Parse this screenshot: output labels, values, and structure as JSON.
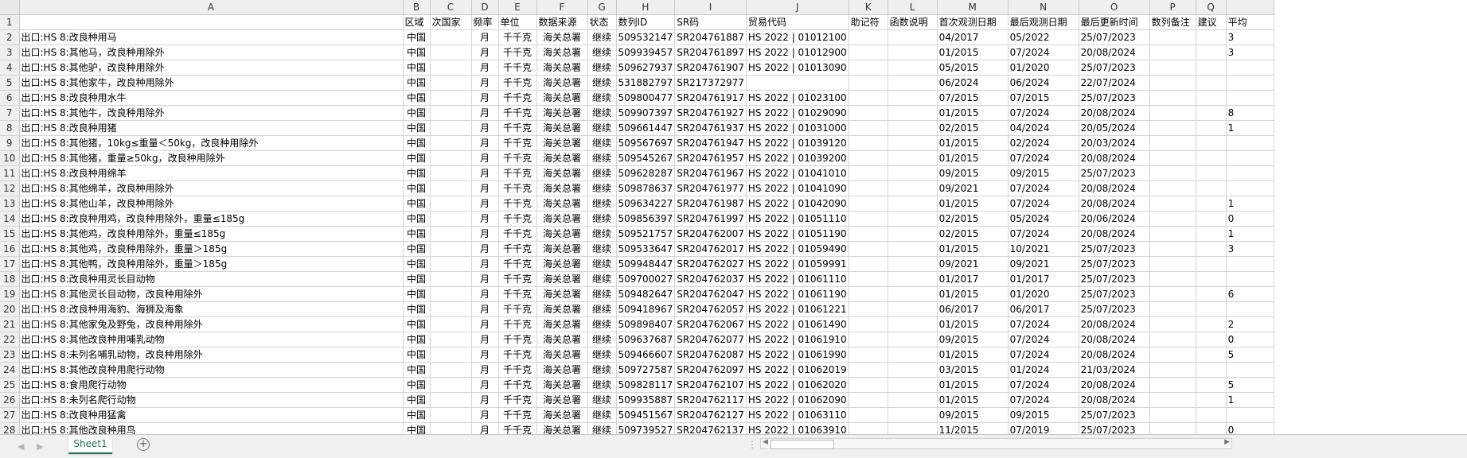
{
  "columns": [
    {
      "letter": "A",
      "header": "",
      "align": "left"
    },
    {
      "letter": "B",
      "header": "区域",
      "align": "center"
    },
    {
      "letter": "C",
      "header": "次国家",
      "align": "center"
    },
    {
      "letter": "D",
      "header": "频率",
      "align": "center"
    },
    {
      "letter": "E",
      "header": "单位",
      "align": "center"
    },
    {
      "letter": "F",
      "header": "数据来源",
      "align": "center"
    },
    {
      "letter": "G",
      "header": "状态",
      "align": "center"
    },
    {
      "letter": "H",
      "header": "数列ID",
      "align": "center"
    },
    {
      "letter": "I",
      "header": "SR码",
      "align": "left"
    },
    {
      "letter": "J",
      "header": "贸易代码",
      "align": "left"
    },
    {
      "letter": "K",
      "header": "助记符",
      "align": "left"
    },
    {
      "letter": "L",
      "header": "函数说明",
      "align": "left"
    },
    {
      "letter": "M",
      "header": "首次观测日期",
      "align": "left"
    },
    {
      "letter": "N",
      "header": "最后观测日期",
      "align": "left"
    },
    {
      "letter": "O",
      "header": "最后更新时间",
      "align": "left"
    },
    {
      "letter": "P",
      "header": "数列备注",
      "align": "left"
    },
    {
      "letter": "Q",
      "header": "建议",
      "align": "left"
    },
    {
      "letter": "",
      "header": "平均",
      "align": "left"
    }
  ],
  "rows": [
    {
      "num": "2",
      "cells": [
        "出口:HS 8:改良种用马",
        "中国",
        "",
        "月",
        "千千克",
        "海关总署",
        "继续",
        "509532147",
        "SR204761887",
        "HS 2022 | 01012100",
        "",
        "",
        "04/2017",
        "05/2022",
        "25/07/2023",
        "",
        "",
        "3"
      ]
    },
    {
      "num": "3",
      "cells": [
        "出口:HS 8:其他马，改良种用除外",
        "中国",
        "",
        "月",
        "千千克",
        "海关总署",
        "继续",
        "509939457",
        "SR204761897",
        "HS 2022 | 01012900",
        "",
        "",
        "01/2015",
        "07/2024",
        "20/08/2024",
        "",
        "",
        "3"
      ]
    },
    {
      "num": "4",
      "cells": [
        "出口:HS 8:其他驴，改良种用除外",
        "中国",
        "",
        "月",
        "千千克",
        "海关总署",
        "继续",
        "509627937",
        "SR204761907",
        "HS 2022 | 01013090",
        "",
        "",
        "05/2015",
        "01/2020",
        "25/07/2023",
        "",
        "",
        ""
      ]
    },
    {
      "num": "5",
      "cells": [
        "出口:HS 8:其他家牛，改良种用除外",
        "中国",
        "",
        "月",
        "千千克",
        "海关总署",
        "继续",
        "531882797",
        "SR217372977",
        "",
        "",
        "",
        "06/2024",
        "06/2024",
        "22/07/2024",
        "",
        "",
        ""
      ]
    },
    {
      "num": "6",
      "cells": [
        "出口:HS 8:改良种用水牛",
        "中国",
        "",
        "月",
        "千千克",
        "海关总署",
        "继续",
        "509800477",
        "SR204761917",
        "HS 2022 | 01023100",
        "",
        "",
        "07/2015",
        "07/2015",
        "25/07/2023",
        "",
        "",
        ""
      ]
    },
    {
      "num": "7",
      "cells": [
        "出口:HS 8:其他牛，改良种用除外",
        "中国",
        "",
        "月",
        "千千克",
        "海关总署",
        "继续",
        "509907397",
        "SR204761927",
        "HS 2022 | 01029090",
        "",
        "",
        "01/2015",
        "07/2024",
        "20/08/2024",
        "",
        "",
        "8"
      ]
    },
    {
      "num": "8",
      "cells": [
        "出口:HS 8:改良种用猪",
        "中国",
        "",
        "月",
        "千千克",
        "海关总署",
        "继续",
        "509661447",
        "SR204761937",
        "HS 2022 | 01031000",
        "",
        "",
        "02/2015",
        "04/2024",
        "20/05/2024",
        "",
        "",
        "1"
      ]
    },
    {
      "num": "9",
      "cells": [
        "出口:HS 8:其他猪，10kg≤重量＜50kg，改良种用除外",
        "中国",
        "",
        "月",
        "千千克",
        "海关总署",
        "继续",
        "509567697",
        "SR204761947",
        "HS 2022 | 01039120",
        "",
        "",
        "01/2015",
        "02/2024",
        "20/03/2024",
        "",
        "",
        ""
      ]
    },
    {
      "num": "10",
      "cells": [
        "出口:HS 8:其他猪，重量≥50kg，改良种用除外",
        "中国",
        "",
        "月",
        "千千克",
        "海关总署",
        "继续",
        "509545267",
        "SR204761957",
        "HS 2022 | 01039200",
        "",
        "",
        "01/2015",
        "07/2024",
        "20/08/2024",
        "",
        "",
        ""
      ]
    },
    {
      "num": "11",
      "cells": [
        "出口:HS 8:改良种用绵羊",
        "中国",
        "",
        "月",
        "千千克",
        "海关总署",
        "继续",
        "509628287",
        "SR204761967",
        "HS 2022 | 01041010",
        "",
        "",
        "09/2015",
        "09/2015",
        "25/07/2023",
        "",
        "",
        ""
      ]
    },
    {
      "num": "12",
      "cells": [
        "出口:HS 8:其他绵羊，改良种用除外",
        "中国",
        "",
        "月",
        "千千克",
        "海关总署",
        "继续",
        "509878637",
        "SR204761977",
        "HS 2022 | 01041090",
        "",
        "",
        "09/2021",
        "07/2024",
        "20/08/2024",
        "",
        "",
        ""
      ]
    },
    {
      "num": "13",
      "cells": [
        "出口:HS 8:其他山羊，改良种用除外",
        "中国",
        "",
        "月",
        "千千克",
        "海关总署",
        "继续",
        "509634227",
        "SR204761987",
        "HS 2022 | 01042090",
        "",
        "",
        "01/2015",
        "07/2024",
        "20/08/2024",
        "",
        "",
        "1"
      ]
    },
    {
      "num": "14",
      "cells": [
        "出口:HS 8:改良种用鸡，改良种用除外，重量≤185g",
        "中国",
        "",
        "月",
        "千千克",
        "海关总署",
        "继续",
        "509856397",
        "SR204761997",
        "HS 2022 | 01051110",
        "",
        "",
        "02/2015",
        "05/2024",
        "20/06/2024",
        "",
        "",
        "0"
      ]
    },
    {
      "num": "15",
      "cells": [
        "出口:HS 8:其他鸡，改良种用除外，重量≤185g",
        "中国",
        "",
        "月",
        "千千克",
        "海关总署",
        "继续",
        "509521757",
        "SR204762007",
        "HS 2022 | 01051190",
        "",
        "",
        "02/2015",
        "07/2024",
        "20/08/2024",
        "",
        "",
        "1"
      ]
    },
    {
      "num": "16",
      "cells": [
        "出口:HS 8:其他鸡，改良种用除外，重量＞185g",
        "中国",
        "",
        "月",
        "千千克",
        "海关总署",
        "继续",
        "509533647",
        "SR204762017",
        "HS 2022 | 01059490",
        "",
        "",
        "01/2015",
        "10/2021",
        "25/07/2023",
        "",
        "",
        "3"
      ]
    },
    {
      "num": "17",
      "cells": [
        "出口:HS 8:其他鸭，改良种用除外，重量＞185g",
        "中国",
        "",
        "月",
        "千千克",
        "海关总署",
        "继续",
        "509948447",
        "SR204762027",
        "HS 2022 | 01059991",
        "",
        "",
        "09/2021",
        "09/2021",
        "25/07/2023",
        "",
        "",
        ""
      ]
    },
    {
      "num": "18",
      "cells": [
        "出口:HS 8:改良种用灵长目动物",
        "中国",
        "",
        "月",
        "千千克",
        "海关总署",
        "继续",
        "509700027",
        "SR204762037",
        "HS 2022 | 01061110",
        "",
        "",
        "01/2017",
        "01/2017",
        "25/07/2023",
        "",
        "",
        ""
      ]
    },
    {
      "num": "19",
      "cells": [
        "出口:HS 8:其他灵长目动物，改良种用除外",
        "中国",
        "",
        "月",
        "千千克",
        "海关总署",
        "继续",
        "509482647",
        "SR204762047",
        "HS 2022 | 01061190",
        "",
        "",
        "01/2015",
        "01/2020",
        "25/07/2023",
        "",
        "",
        "6"
      ]
    },
    {
      "num": "20",
      "cells": [
        "出口:HS 8:改良种用海豹、海狮及海象",
        "中国",
        "",
        "月",
        "千千克",
        "海关总署",
        "继续",
        "509418967",
        "SR204762057",
        "HS 2022 | 01061221",
        "",
        "",
        "06/2017",
        "06/2017",
        "25/07/2023",
        "",
        "",
        ""
      ]
    },
    {
      "num": "21",
      "cells": [
        "出口:HS 8:其他家兔及野兔，改良种用除外",
        "中国",
        "",
        "月",
        "千千克",
        "海关总署",
        "继续",
        "509898407",
        "SR204762067",
        "HS 2022 | 01061490",
        "",
        "",
        "01/2015",
        "07/2024",
        "20/08/2024",
        "",
        "",
        "2"
      ]
    },
    {
      "num": "22",
      "cells": [
        "出口:HS 8:其他改良种用哺乳动物",
        "中国",
        "",
        "月",
        "千千克",
        "海关总署",
        "继续",
        "509637687",
        "SR204762077",
        "HS 2022 | 01061910",
        "",
        "",
        "09/2015",
        "07/2024",
        "20/08/2024",
        "",
        "",
        "0"
      ]
    },
    {
      "num": "23",
      "cells": [
        "出口:HS 8:未列名哺乳动物，改良种用除外",
        "中国",
        "",
        "月",
        "千千克",
        "海关总署",
        "继续",
        "509466607",
        "SR204762087",
        "HS 2022 | 01061990",
        "",
        "",
        "01/2015",
        "07/2024",
        "20/08/2024",
        "",
        "",
        "5"
      ]
    },
    {
      "num": "24",
      "cells": [
        "出口:HS 8:其他改良种用爬行动物",
        "中国",
        "",
        "月",
        "千千克",
        "海关总署",
        "继续",
        "509727587",
        "SR204762097",
        "HS 2022 | 01062019",
        "",
        "",
        "03/2015",
        "01/2024",
        "21/03/2024",
        "",
        "",
        ""
      ]
    },
    {
      "num": "25",
      "cells": [
        "出口:HS 8:食用爬行动物",
        "中国",
        "",
        "月",
        "千千克",
        "海关总署",
        "继续",
        "509828117",
        "SR204762107",
        "HS 2022 | 01062020",
        "",
        "",
        "01/2015",
        "07/2024",
        "20/08/2024",
        "",
        "",
        "5"
      ]
    },
    {
      "num": "26",
      "cells": [
        "出口:HS 8:未列名爬行动物",
        "中国",
        "",
        "月",
        "千千克",
        "海关总署",
        "继续",
        "509935887",
        "SR204762117",
        "HS 2022 | 01062090",
        "",
        "",
        "01/2015",
        "07/2024",
        "20/08/2024",
        "",
        "",
        "1"
      ]
    },
    {
      "num": "27",
      "cells": [
        "出口:HS 8:改良种用猛禽",
        "中国",
        "",
        "月",
        "千千克",
        "海关总署",
        "继续",
        "509451567",
        "SR204762127",
        "HS 2022 | 01063110",
        "",
        "",
        "09/2015",
        "09/2015",
        "25/07/2023",
        "",
        "",
        ""
      ]
    },
    {
      "num": "28",
      "cells": [
        "出口:HS 8:其他改良种用鸟",
        "中国",
        "",
        "月",
        "千千克",
        "海关总署",
        "继续",
        "509739527",
        "SR204762137",
        "HS 2022 | 01063910",
        "",
        "",
        "11/2015",
        "07/2019",
        "25/07/2023",
        "",
        "",
        "0"
      ]
    }
  ],
  "header_row_num": "1",
  "sheet_tab": "Sheet1",
  "add_sheet_glyph": "+",
  "nav_prev_glyph": "◀",
  "nav_next_glyph": "▶",
  "dots_glyph": "⋮",
  "accent_color": "#217346"
}
